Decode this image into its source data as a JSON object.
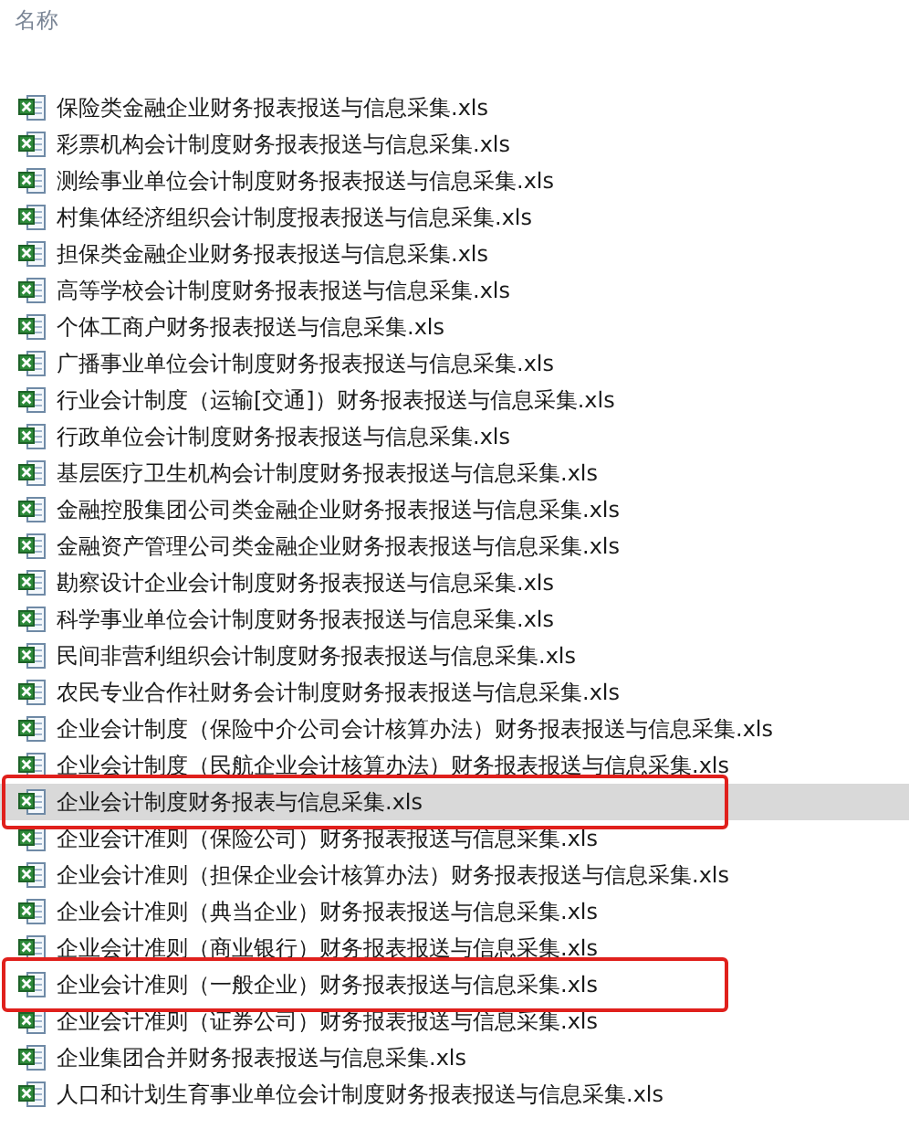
{
  "header": {
    "column_name": "名称"
  },
  "files": [
    {
      "name": "保险类金融企业财务报表报送与信息采集.xls",
      "selected": false,
      "outlined": false
    },
    {
      "name": "彩票机构会计制度财务报表报送与信息采集.xls",
      "selected": false,
      "outlined": false
    },
    {
      "name": "测绘事业单位会计制度财务报表报送与信息采集.xls",
      "selected": false,
      "outlined": false
    },
    {
      "name": "村集体经济组织会计制度报表报送与信息采集.xls",
      "selected": false,
      "outlined": false
    },
    {
      "name": "担保类金融企业财务报表报送与信息采集.xls",
      "selected": false,
      "outlined": false
    },
    {
      "name": "高等学校会计制度财务报表报送与信息采集.xls",
      "selected": false,
      "outlined": false
    },
    {
      "name": "个体工商户财务报表报送与信息采集.xls",
      "selected": false,
      "outlined": false
    },
    {
      "name": "广播事业单位会计制度财务报表报送与信息采集.xls",
      "selected": false,
      "outlined": false
    },
    {
      "name": "行业会计制度（运输[交通]）财务报表报送与信息采集.xls",
      "selected": false,
      "outlined": false
    },
    {
      "name": "行政单位会计制度财务报表报送与信息采集.xls",
      "selected": false,
      "outlined": false
    },
    {
      "name": "基层医疗卫生机构会计制度财务报表报送与信息采集.xls",
      "selected": false,
      "outlined": false
    },
    {
      "name": "金融控股集团公司类金融企业财务报表报送与信息采集.xls",
      "selected": false,
      "outlined": false
    },
    {
      "name": "金融资产管理公司类金融企业财务报表报送与信息采集.xls",
      "selected": false,
      "outlined": false
    },
    {
      "name": "勘察设计企业会计制度财务报表报送与信息采集.xls",
      "selected": false,
      "outlined": false
    },
    {
      "name": "科学事业单位会计制度财务报表报送与信息采集.xls",
      "selected": false,
      "outlined": false
    },
    {
      "name": "民间非营利组织会计制度财务报表报送与信息采集.xls",
      "selected": false,
      "outlined": false
    },
    {
      "name": "农民专业合作社财务会计制度财务报表报送与信息采集.xls",
      "selected": false,
      "outlined": false
    },
    {
      "name": "企业会计制度（保险中介公司会计核算办法）财务报表报送与信息采集.xls",
      "selected": false,
      "outlined": false
    },
    {
      "name": "企业会计制度（民航企业会计核算办法）财务报表报送与信息采集.xls",
      "selected": false,
      "outlined": false
    },
    {
      "name": "企业会计制度财务报表与信息采集.xls",
      "selected": true,
      "outlined": true
    },
    {
      "name": "企业会计准则（保险公司）财务报表报送与信息采集.xls",
      "selected": false,
      "outlined": false
    },
    {
      "name": "企业会计准则（担保企业会计核算办法）财务报表报送与信息采集.xls",
      "selected": false,
      "outlined": false
    },
    {
      "name": "企业会计准则（典当企业）财务报表报送与信息采集.xls",
      "selected": false,
      "outlined": false
    },
    {
      "name": "企业会计准则（商业银行）财务报表报送与信息采集.xls",
      "selected": false,
      "outlined": false
    },
    {
      "name": "企业会计准则（一般企业）财务报表报送与信息采集.xls",
      "selected": false,
      "outlined": true
    },
    {
      "name": "企业会计准则（证券公司）财务报表报送与信息采集.xls",
      "selected": false,
      "outlined": false
    },
    {
      "name": "企业集团合并财务报表报送与信息采集.xls",
      "selected": false,
      "outlined": false
    },
    {
      "name": "人口和计划生育事业单位会计制度财务报表报送与信息采集.xls",
      "selected": false,
      "outlined": false
    }
  ]
}
